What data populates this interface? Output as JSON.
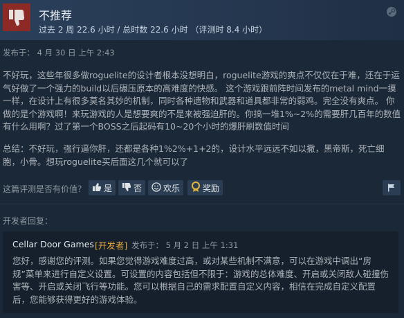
{
  "review": {
    "title": "不推荐",
    "playtime": "过去 2 周 22.6 小时 / 总时数 22.6 小时 （评测时 8.4 小时）",
    "posted": "发布于：  4 月 30 日 上午 2:43",
    "body": "不好玩，这些年很多做roguelite的设计者根本没想明白，roguelite游戏的爽点不仅仅在于难，还在于运气好做了一个强力的build以后碾压原本的高难度的快感。 这个游戏跟前阵时间发布的metal mind一摸一样，在设计上有很多莫名其妙的机制，同时各种遗物和武器和道具都非常的弱鸡。完全没有爽点。 你做的是个游戏啊！来玩游戏的人是想要爽的不是来被强迫肝的。你搞一堆1%~2%的需要肝几百年的数值有什么用啊？过了第一个BOSS之后起码有10~20个小时的爆肝刷数值时间",
    "summary": "总结：不好玩，强行逼你肝，还都是各种1%2%+1+2的，设计水平远远不如以撒，黑帝斯，死亡细胞，小骨。想玩roguelite买后面这几个就可以了"
  },
  "helpful": {
    "question": "这篇评测是否有价值？",
    "yes": "是",
    "no": "否",
    "funny": "欢乐",
    "award": "奖励"
  },
  "developer": {
    "label": "开发者回复：",
    "name": "Cellar Door Games",
    "badge": "[开发者]",
    "date": "发布于：  5 月 2 日 上午 1:31",
    "text": "您好，感谢您的评测。如果您觉得游戏难度过高，或对某些机制不满意，可以在游戏中调出“房规”菜单来进行自定义设置。可设置的内容包括但不限于：游戏的总体难度、开启或关闭敌人碰撞伤害等、开启或关闭飞行等功能。您可以根据自己的需求配置自定义内容，相信在完成自定义配置后，您能够获得更好的游戏体验。"
  },
  "colors": {
    "background": "#1b2838",
    "not_recommended": "#8e2a26",
    "developer_badge": "#e6a93c"
  },
  "icons": [
    "thumbs-down-icon",
    "steam-icon",
    "thumbs-up-icon",
    "smiley-icon",
    "award-icon",
    "flag-icon"
  ]
}
